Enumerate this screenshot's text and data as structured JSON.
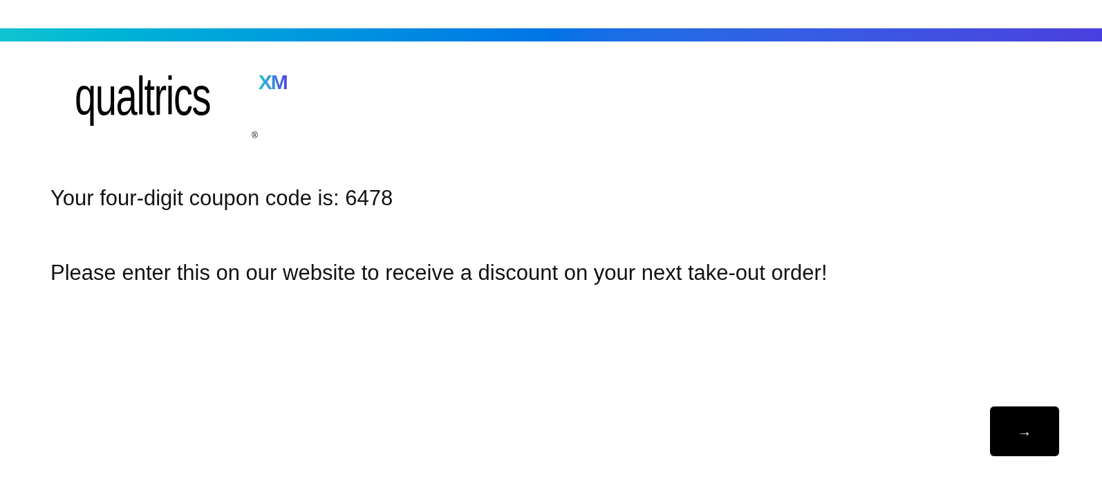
{
  "logo": {
    "wordmark": "qualtrics",
    "superscript": "XM",
    "registered": "®"
  },
  "message": [
    {
      "text": "Your four-digit coupon code is: 6478"
    },
    {
      "text": "Please enter this on our website to receive a discount on your next take-out order!"
    }
  ],
  "next_button": {
    "label": "→"
  }
}
